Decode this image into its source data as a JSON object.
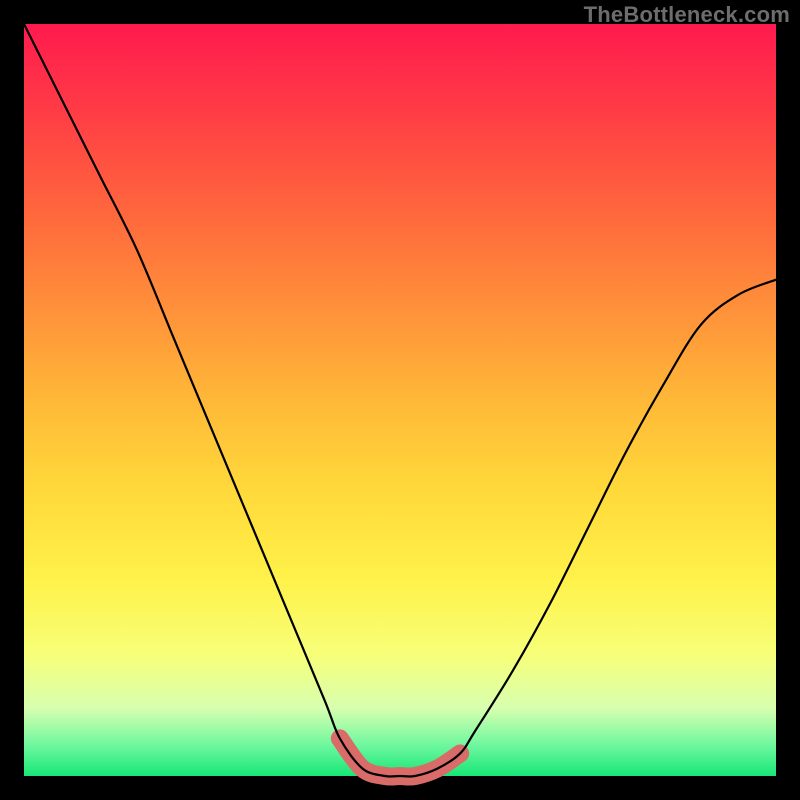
{
  "watermark": "TheBottleneck.com",
  "chart_data": {
    "type": "line",
    "title": "",
    "xlabel": "",
    "ylabel": "",
    "xlim": [
      0,
      100
    ],
    "ylim": [
      0,
      100
    ],
    "grid": false,
    "legend": false,
    "description": "V-shaped bottleneck curve over a vertical red→green gradient. A thin black curve plunges from top-left toward a flat minimum near x≈45–55 and rises toward the upper right. A thick salmon segment highlights the flat minimum region near the bottom.",
    "series": [
      {
        "name": "bottleneck-curve",
        "x": [
          0,
          5,
          10,
          15,
          20,
          25,
          30,
          35,
          40,
          42,
          45,
          48,
          50,
          52,
          55,
          58,
          60,
          65,
          70,
          75,
          80,
          85,
          90,
          95,
          100
        ],
        "y": [
          100,
          90,
          80,
          70,
          58,
          46,
          34,
          22,
          10,
          5,
          1,
          0,
          0,
          0,
          1,
          3,
          6,
          14,
          23,
          33,
          43,
          52,
          60,
          64,
          66
        ]
      },
      {
        "name": "highlight-minimum",
        "x": [
          42,
          45,
          48,
          50,
          52,
          55,
          58
        ],
        "y": [
          5,
          1,
          0,
          0,
          0,
          1,
          3
        ]
      }
    ],
    "gradient_stops": [
      {
        "pos": 0.0,
        "color": "#ff1a4e"
      },
      {
        "pos": 0.12,
        "color": "#ff3d45"
      },
      {
        "pos": 0.26,
        "color": "#ff6a3c"
      },
      {
        "pos": 0.38,
        "color": "#ff913a"
      },
      {
        "pos": 0.5,
        "color": "#ffb838"
      },
      {
        "pos": 0.62,
        "color": "#ffd93a"
      },
      {
        "pos": 0.74,
        "color": "#fff24a"
      },
      {
        "pos": 0.84,
        "color": "#f7ff7a"
      },
      {
        "pos": 0.91,
        "color": "#d7ffb0"
      },
      {
        "pos": 0.96,
        "color": "#6cf79e"
      },
      {
        "pos": 1.0,
        "color": "#17e776"
      }
    ]
  }
}
